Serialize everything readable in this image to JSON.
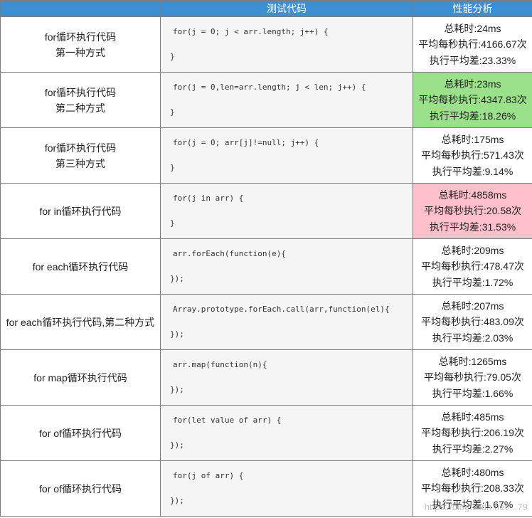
{
  "header": {
    "col1": "",
    "col2": "测试代码",
    "col3": "性能分析"
  },
  "rows": [
    {
      "desc": [
        "for循环执行代码",
        "第一种方式"
      ],
      "code_open": "for(j = 0; j < arr.length; j++) {",
      "code_close": "}",
      "result": [
        "总耗时:24ms",
        "平均每秒执行:4166.67次",
        "执行平均差:23.33%"
      ],
      "highlight": "none"
    },
    {
      "desc": [
        "for循环执行代码",
        "第二种方式"
      ],
      "code_open": "for(j = 0,len=arr.length; j < len; j++) {",
      "code_close": "}",
      "result": [
        "总耗时:23ms",
        "平均每秒执行:4347.83次",
        "执行平均差:18.26%"
      ],
      "highlight": "best"
    },
    {
      "desc": [
        "for循环执行代码",
        "第三种方式"
      ],
      "code_open": "for(j = 0; arr[j]!=null; j++) {",
      "code_close": "}",
      "result": [
        "总耗时:175ms",
        "平均每秒执行:571.43次",
        "执行平均差:9.14%"
      ],
      "highlight": "none"
    },
    {
      "desc": [
        "for in循环执行代码"
      ],
      "code_open": "for(j in arr) {",
      "code_close": "}",
      "result": [
        "总耗时:4858ms",
        "平均每秒执行:20.58次",
        "执行平均差:31.53%"
      ],
      "highlight": "worst"
    },
    {
      "desc": [
        "for each循环执行代码"
      ],
      "code_open": "arr.forEach(function(e){",
      "code_close": "});",
      "result": [
        "总耗时:209ms",
        "平均每秒执行:478.47次",
        "执行平均差:1.72%"
      ],
      "highlight": "none"
    },
    {
      "desc": [
        "for each循环执行代码,第二种方式"
      ],
      "code_open": "Array.prototype.forEach.call(arr,function(el){",
      "code_close": "});",
      "result": [
        "总耗时:207ms",
        "平均每秒执行:483.09次",
        "执行平均差:2.03%"
      ],
      "highlight": "none"
    },
    {
      "desc": [
        "for map循环执行代码"
      ],
      "code_open": "arr.map(function(n){",
      "code_close": "});",
      "result": [
        "总耗时:1265ms",
        "平均每秒执行:79.05次",
        "执行平均差:1.66%"
      ],
      "highlight": "none"
    },
    {
      "desc": [
        "for of循环执行代码"
      ],
      "code_open": "for(let value of arr) {",
      "code_close": "});",
      "result": [
        "总耗时:485ms",
        "平均每秒执行:206.19次",
        "执行平均差:2.27%"
      ],
      "highlight": "none"
    },
    {
      "desc": [
        "for of循环执行代码"
      ],
      "code_open": "for(j of arr) {",
      "code_close": "});",
      "result": [
        "总耗时:480ms",
        "平均每秒执行:208.33次",
        "执行平均差:1.67%"
      ],
      "highlight": "none"
    }
  ],
  "watermark": "https://blog.csdn.net/...79",
  "colors": {
    "header_bg": "#3e8fd1",
    "best_bg": "#9be08a",
    "worst_bg": "#ffc0cb",
    "code_bg": "#f5f5f5"
  }
}
